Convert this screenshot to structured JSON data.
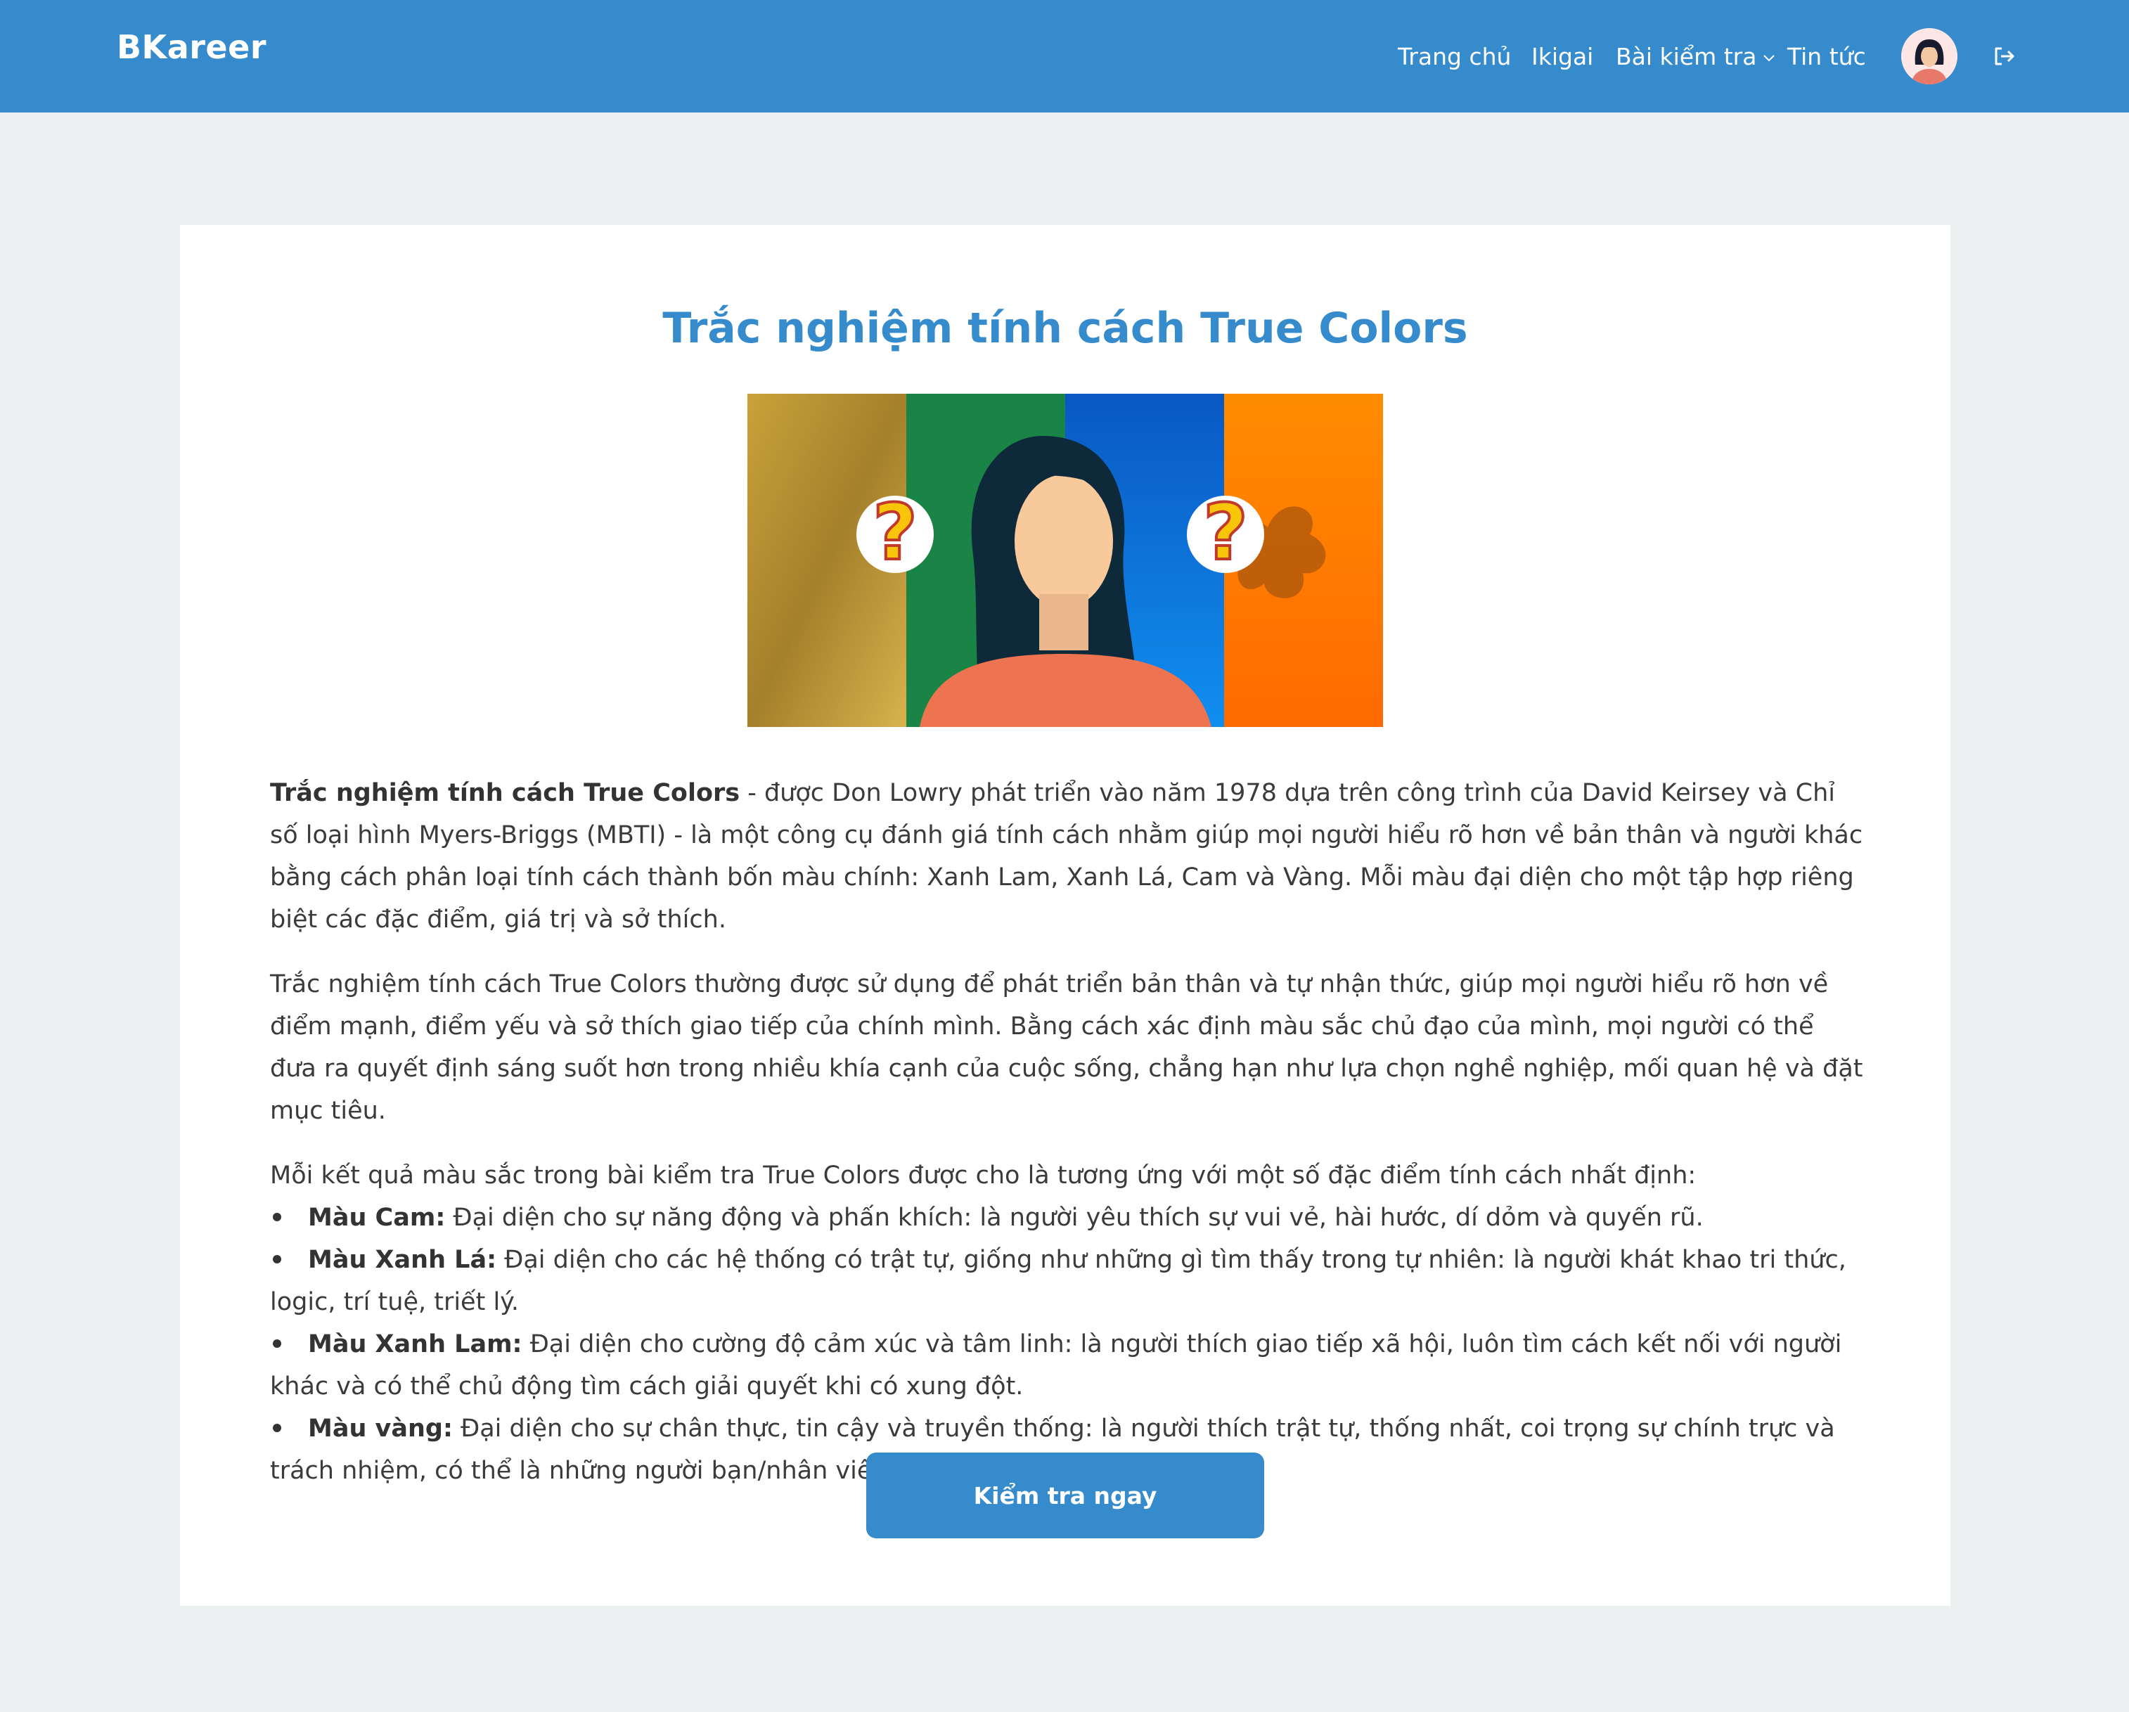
{
  "header": {
    "brand": "BKareer",
    "nav": {
      "home": "Trang chủ",
      "ikigai": "Ikigai",
      "tests": "Bài kiểm tra",
      "news": "Tin tức"
    }
  },
  "main": {
    "title": "Trắc nghiệm tính cách True Colors",
    "paragraphs": {
      "p1_bold": "Trắc nghiệm tính cách True Colors",
      "p1_rest": " - được Don Lowry phát triển vào năm 1978 dựa trên công trình của David Keirsey và Chỉ số loại hình Myers-Briggs (MBTI) - là một công cụ đánh giá tính cách nhằm giúp mọi người hiểu rõ hơn về bản thân và người khác bằng cách phân loại tính cách thành bốn màu chính: Xanh Lam, Xanh Lá, Cam và Vàng. Mỗi màu đại diện cho một tập hợp riêng biệt các đặc điểm, giá trị và sở thích.",
      "p2": "Trắc nghiệm tính cách True Colors thường được sử dụng để phát triển bản thân và tự nhận thức, giúp mọi người hiểu rõ hơn về điểm mạnh, điểm yếu và sở thích giao tiếp của chính mình. Bằng cách xác định màu sắc chủ đạo của mình, mọi người có thể đưa ra quyết định sáng suốt hơn trong nhiều khía cạnh của cuộc sống, chẳng hạn như lựa chọn nghề nghiệp, mối quan hệ và đặt mục tiêu.",
      "p3": "Mỗi kết quả màu sắc trong bài kiểm tra True Colors được cho là tương ứng với một số đặc điểm tính cách nhất định:"
    },
    "colors": [
      {
        "label": "Màu Cam:",
        "desc": " Đại diện cho sự năng động và phấn khích: là người yêu thích sự vui vẻ, hài hước, dí dỏm và quyến rũ."
      },
      {
        "label": "Màu Xanh Lá:",
        "desc": " Đại diện cho các hệ thống có trật tự, giống như những gì tìm thấy trong tự nhiên: là người khát khao tri thức, logic, trí tuệ, triết lý."
      },
      {
        "label": "Màu Xanh Lam:",
        "desc": " Đại diện cho cường độ cảm xúc và tâm linh: là người thích giao tiếp xã hội, luôn tìm cách kết nối với người khác và có thể chủ động tìm cách giải quyết khi có xung đột."
      },
      {
        "label": "Màu vàng:",
        "desc": " Đại diện cho sự chân thực, tin cậy và truyền thống: là người thích trật tự, thống nhất, coi trọng sự chính trực và trách nhiệm, có thể là những người bạn/nhân viên đáng tin cậy."
      }
    ],
    "cta_label": "Kiểm tra ngay"
  },
  "colors": {
    "primary": "#358bcb",
    "page_bg": "#ecf0f1",
    "text": "#3b3b3b"
  }
}
